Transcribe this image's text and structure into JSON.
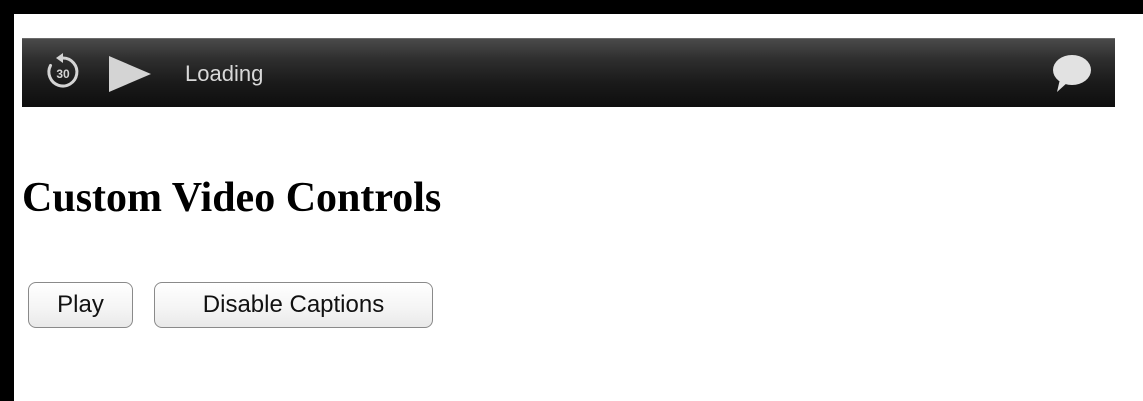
{
  "player": {
    "skip_back_amount": "30",
    "status_text": "Loading",
    "colors": {
      "bar_top": "#4a4a4a",
      "bar_bottom": "#0e0e0e",
      "icon": "#d4d4d4",
      "status_text": "#d8d8d8"
    },
    "icons": {
      "skip_back": "replay-30-icon",
      "play": "play-icon",
      "captions": "speech-bubble-icon"
    }
  },
  "page": {
    "heading": "Custom Video Controls",
    "buttons": {
      "play_label": "Play",
      "captions_label": "Disable Captions"
    }
  }
}
